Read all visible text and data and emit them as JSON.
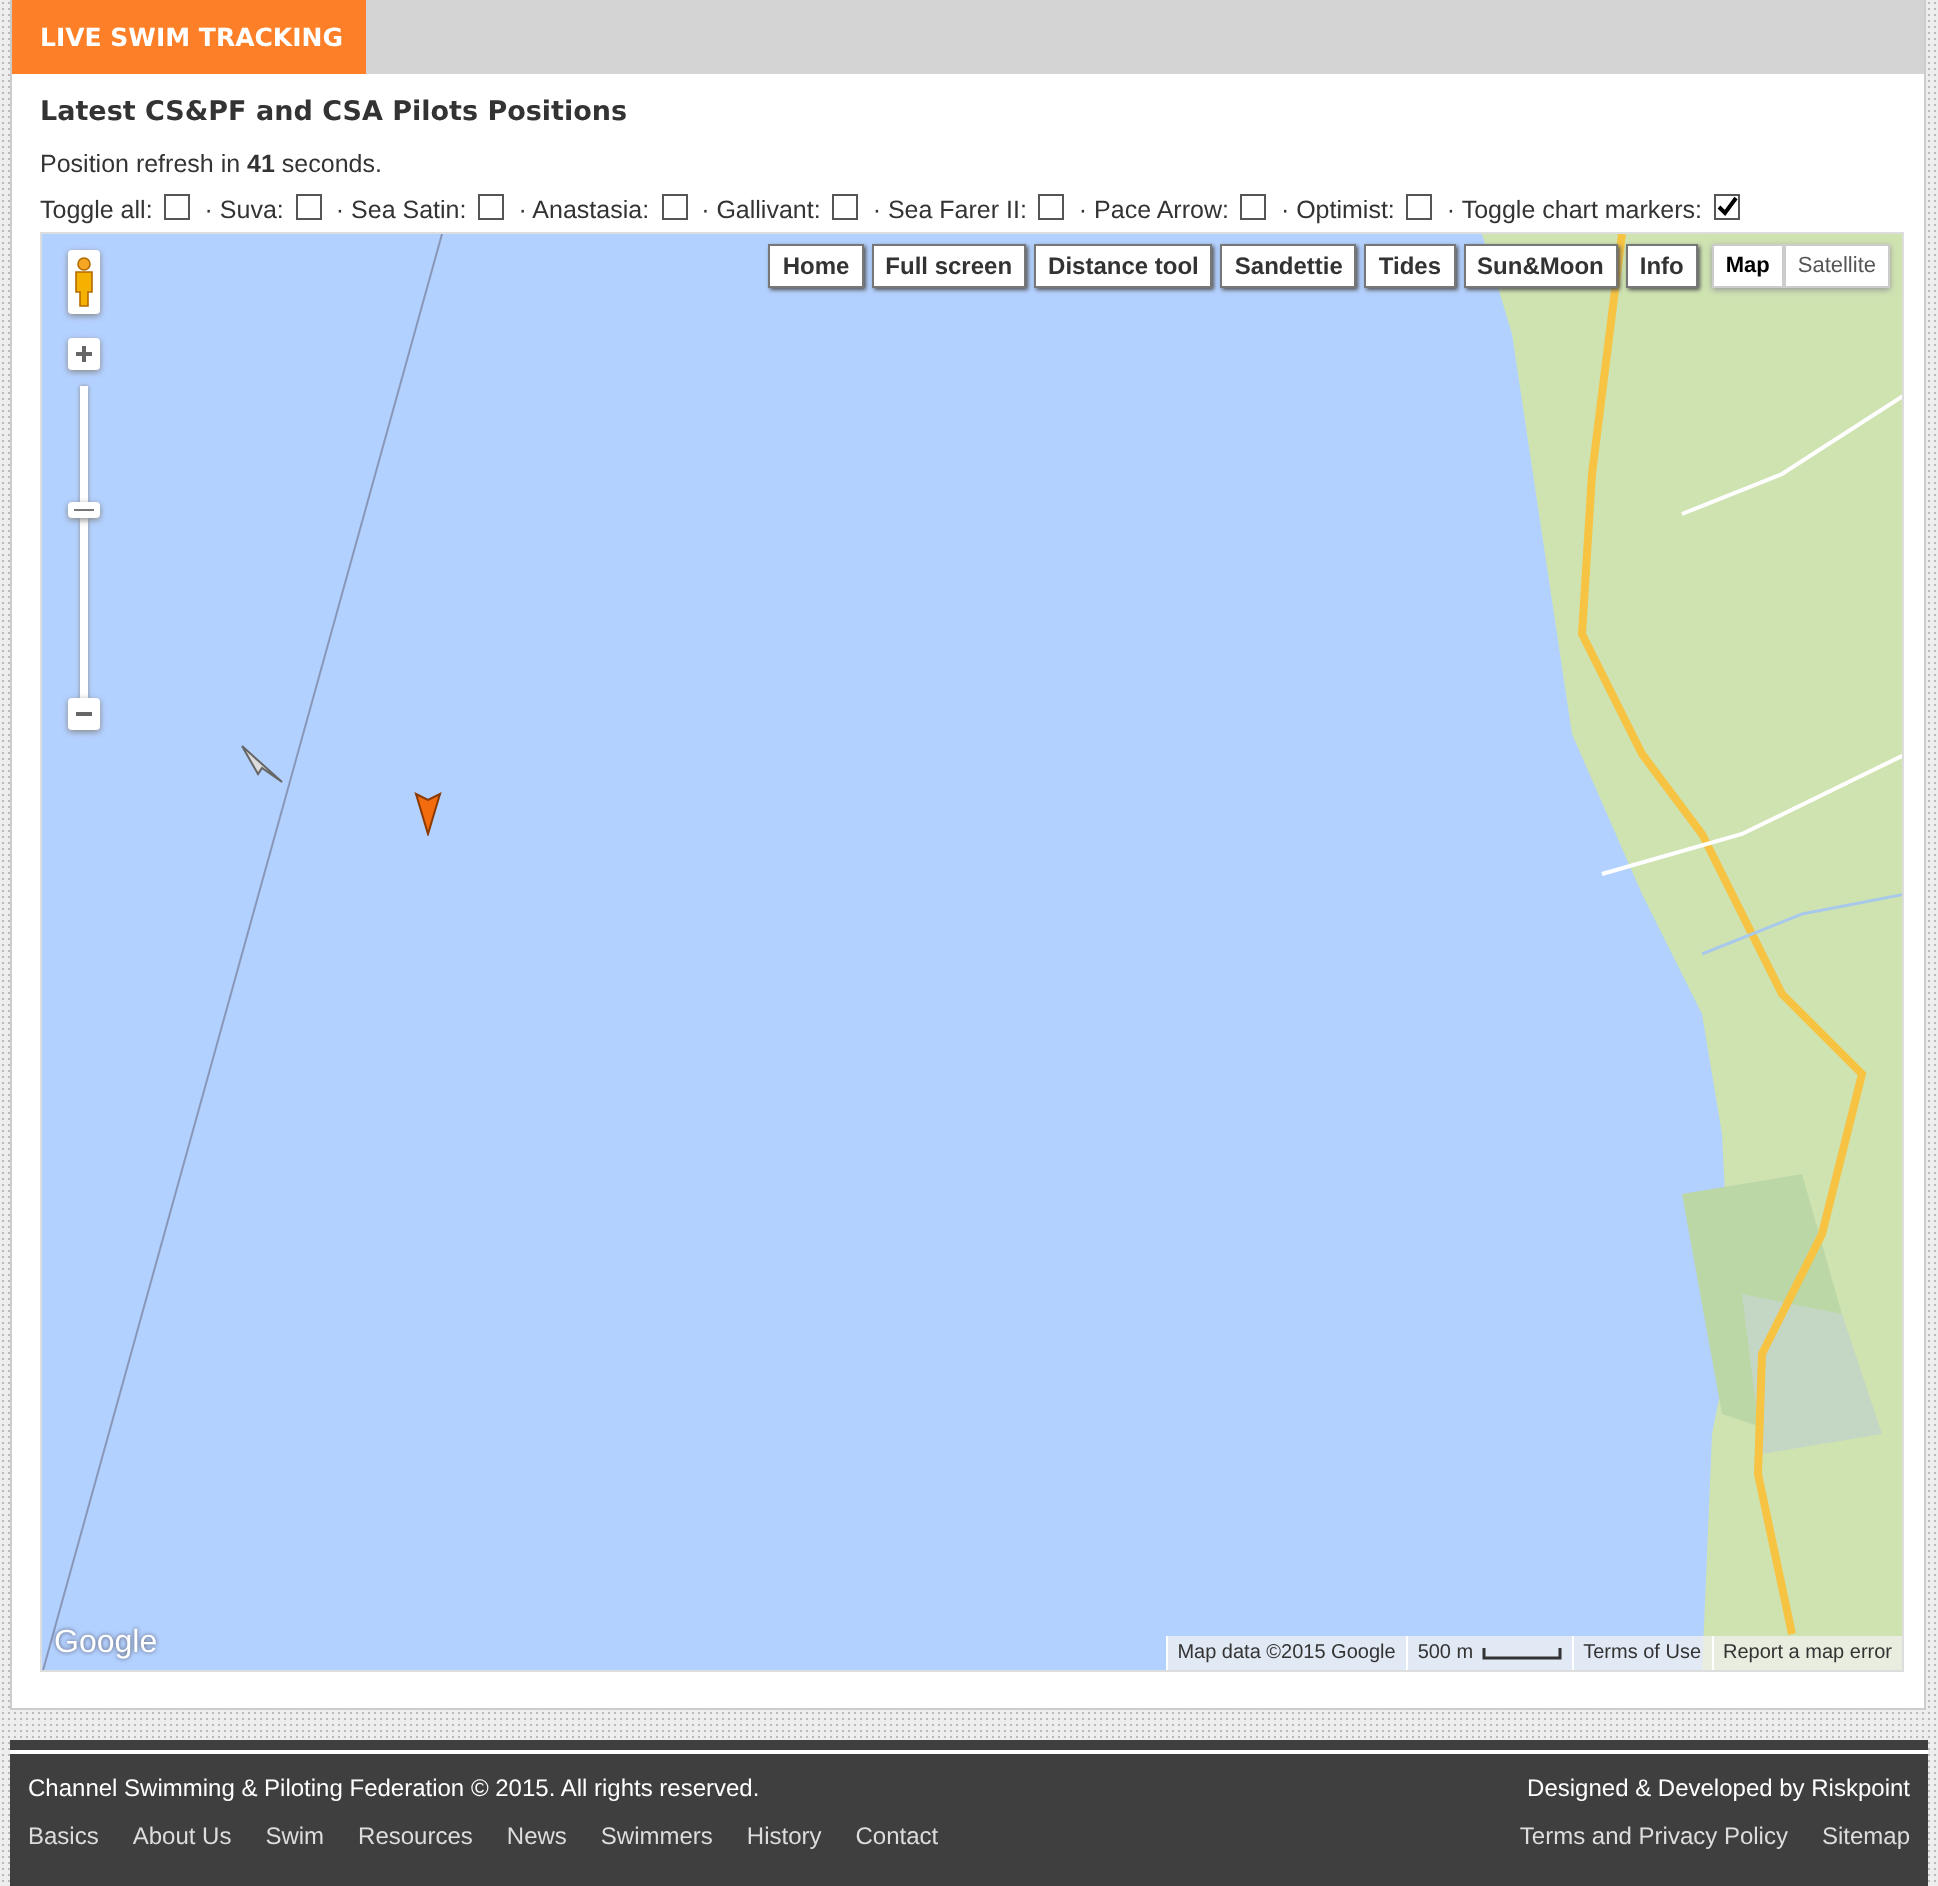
{
  "header": {
    "tab": "LIVE SWIM TRACKING"
  },
  "title": "Latest CS&PF and CSA Pilots Positions",
  "refresh": "Position refresh in **41** seconds.",
  "toggles": [
    {
      "label": "Toggle all:",
      "checked": false
    },
    {
      "label": "· Suva:",
      "checked": false
    },
    {
      "label": "· Sea Satin:",
      "checked": false
    },
    {
      "label": "· Anastasia:",
      "checked": false
    },
    {
      "label": "· Gallivant:",
      "checked": false
    },
    {
      "label": "· Sea Farer II:",
      "checked": false
    },
    {
      "label": "· Pace Arrow:",
      "checked": false
    },
    {
      "label": "· Optimist:",
      "checked": false
    },
    {
      "label": "· Toggle chart markers:",
      "checked": true
    }
  ],
  "map": {
    "buttons": [
      "Home",
      "Full screen",
      "Distance tool",
      "Sandettie",
      "Tides",
      "Sun&Moon",
      "Info"
    ],
    "map_types": [
      {
        "label": "Map",
        "selected": true
      },
      {
        "label": "Satellite",
        "selected": false
      }
    ],
    "logo": "Google",
    "attribution": "Map data ©2015 Google",
    "scale": "500 m",
    "terms": "Terms of Use",
    "report": "Report a map error"
  },
  "footer": {
    "copyright": "Channel Swimming & Piloting Federation © 2015. All rights reserved.",
    "credit": "Designed & Developed by Riskpoint",
    "links": [
      "Basics",
      "About Us",
      "Swim",
      "Resources",
      "News",
      "Swimmers",
      "History",
      "Contact"
    ],
    "right_links": [
      "Terms and Privacy Policy",
      "Sitemap"
    ]
  }
}
